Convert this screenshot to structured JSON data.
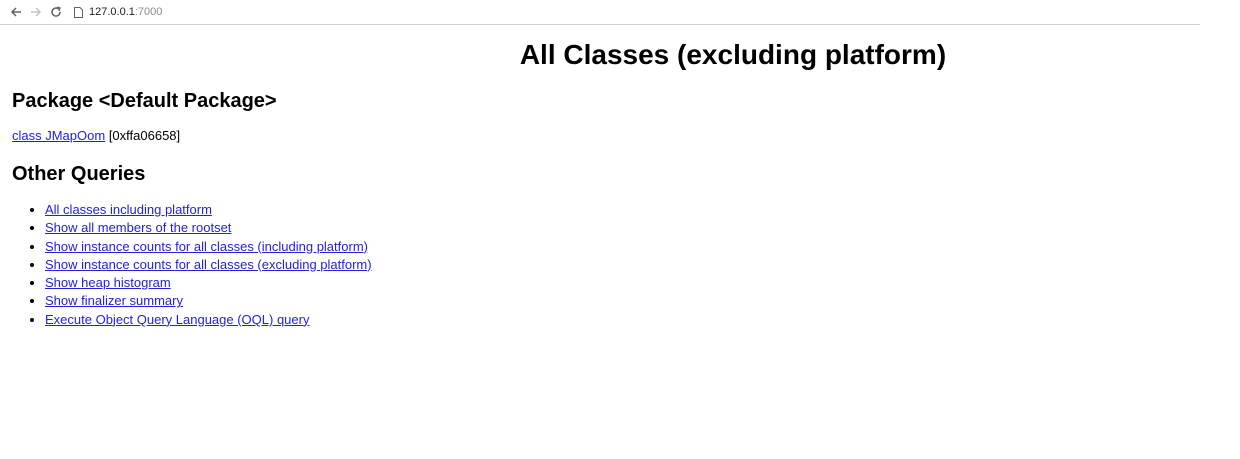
{
  "browser": {
    "url_host": "127.0.0.1",
    "url_port": ":7000"
  },
  "page": {
    "title": "All Classes (excluding platform)",
    "package_heading": "Package <Default Package>",
    "class_link": "class JMapOom",
    "class_address": " [0xffa06658]",
    "other_heading": "Other Queries",
    "queries": [
      "All classes including platform",
      "Show all members of the rootset",
      "Show instance counts for all classes (including platform)",
      "Show instance counts for all classes (excluding platform)",
      "Show heap histogram",
      "Show finalizer summary",
      "Execute Object Query Language (OQL) query"
    ]
  },
  "icons": {
    "back": "back-arrow-icon",
    "forward": "forward-arrow-icon",
    "reload": "reload-icon",
    "page": "page-icon"
  },
  "colors": {
    "link": "#2222dd"
  }
}
